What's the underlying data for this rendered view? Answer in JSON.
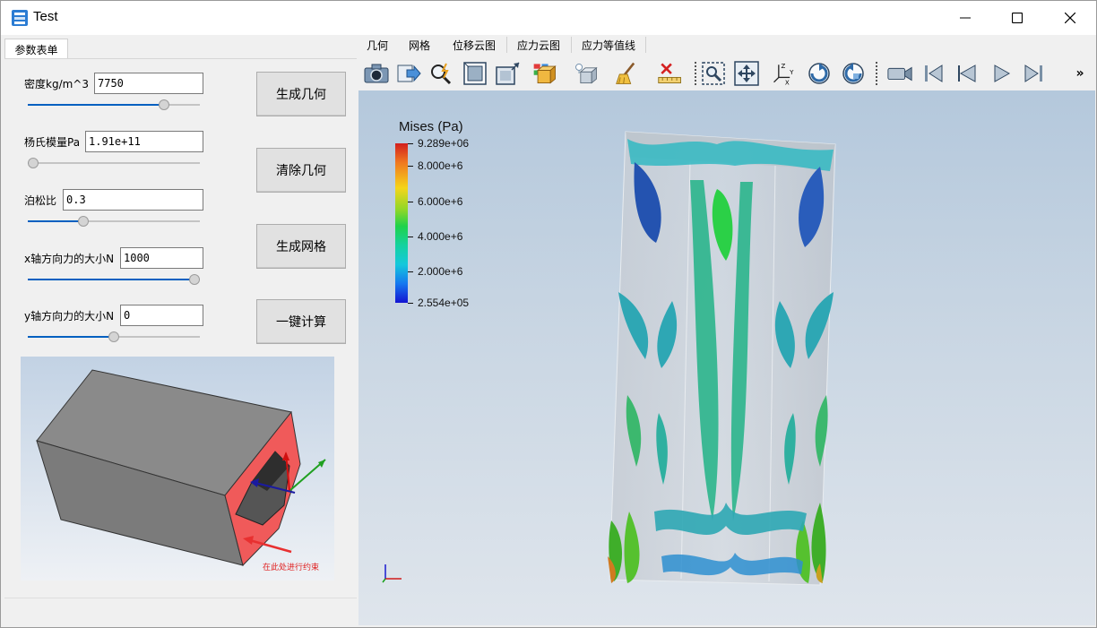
{
  "window": {
    "title": "Test"
  },
  "left": {
    "tab_label": "参数表单",
    "fields": [
      {
        "label": "密度kg/m^3",
        "value": "7750",
        "slider": 0.81
      },
      {
        "label": "杨氏模量Pa",
        "value": "1.91e+11",
        "slider": 0.0
      },
      {
        "label": "泊松比",
        "value": "0.3",
        "slider": 0.31
      },
      {
        "label": "x轴方向力的大小N",
        "value": "1000",
        "slider": 1.0
      },
      {
        "label": "y轴方向力的大小N",
        "value": "0",
        "slider": 0.5
      }
    ],
    "buttons": {
      "generate_geometry": "生成几何",
      "clear_geometry": "清除几何",
      "generate_mesh": "生成网格",
      "one_click_compute": "一键计算"
    },
    "preview": {
      "annotation": "在此处进行约束"
    }
  },
  "right": {
    "menu": [
      "几何",
      "网格",
      "位移云图",
      "应力云图",
      "应力等值线"
    ],
    "toolbar_icons": [
      "camera-icon",
      "export-icon",
      "find-data-icon",
      "reset-camera-icon",
      "zoom-to-box-icon",
      "select-cells-icon",
      "select-points-icon",
      "clear-selection-icon",
      "ruler-icon",
      "zoom-to-selection-icon",
      "fit-view-icon",
      "axes-orient-icon",
      "rotate-cw-icon",
      "rotate-ccw-icon",
      "video-camera-icon",
      "first-frame-icon",
      "previous-frame-icon",
      "play-icon",
      "last-frame-icon",
      "overflow-icon"
    ],
    "overflow_label": "»",
    "legend": {
      "title": "Mises (Pa)",
      "ticks": [
        "9.289e+06",
        "8.000e+6",
        "6.000e+6",
        "4.000e+6",
        "2.000e+6",
        "2.554e+05"
      ],
      "tick_positions": [
        1.0,
        0.857,
        0.637,
        0.416,
        0.196,
        0.0
      ]
    },
    "colors": {
      "bar_top": "#d21e1e",
      "bar_bottom": "#1414d2",
      "viewport_top": "#b4c8dc",
      "viewport_bottom": "#dfe5ec"
    }
  }
}
